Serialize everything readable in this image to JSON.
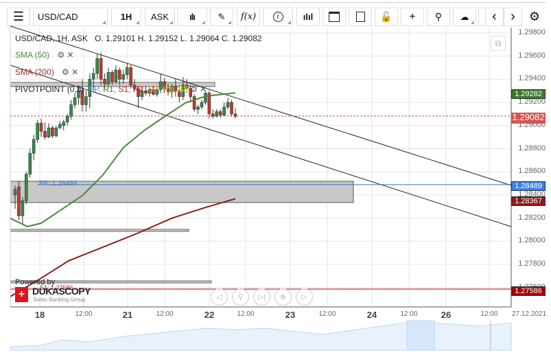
{
  "toolbar": {
    "menu_icon": "hamburger-icon",
    "instrument": "USD/CAD",
    "period": "1H",
    "side": "ASK",
    "chart_type_icon": "candles-icon",
    "draw_icon": "pencil-icon",
    "indicators_label": "f(x)",
    "info_icon": "info-icon",
    "volume_icon": "bar-chart-icon",
    "calendar_icon": "calendar-icon",
    "news_icon": "news-icon",
    "lock_icon": "unlock-icon",
    "crosshair_icon": "crosshair-icon",
    "zoom_icon": "zoom-chart-icon",
    "upload_icon": "cloud-upload-icon",
    "prev": "‹",
    "next": "›",
    "settings_icon": "gear-icon"
  },
  "header": {
    "title": "USD/CAD, 1H, ASK",
    "ohlc": "O. 1.29101 H. 1.29152 L. 1.29064 C. 1.29082"
  },
  "indicators": [
    {
      "label": "SMA (50)",
      "color": "#4a8a3a"
    },
    {
      "label": "SMA (200)",
      "color": "#a03030"
    }
  ],
  "pivot": {
    "label": "PIVOTPOINT (0,8)",
    "levels": [
      {
        "t": "PP,",
        "c": "#4a90e2"
      },
      {
        "t": "R1,",
        "c": "#3a8a2a"
      },
      {
        "t": "S1,",
        "c": "#c02020"
      },
      {
        "t": "R2,",
        "c": "#e02020"
      },
      {
        "t": "S2,",
        "c": "#f08000"
      },
      {
        "t": "R3,",
        "c": "#e0b000"
      },
      {
        "t": "S3",
        "c": "#f0e000"
      }
    ],
    "pp_text": "PP: 1.28489"
  },
  "price_axis": [
    "1.29800",
    "1.29600",
    "1.29400",
    "1.29200",
    "1.29000",
    "1.28800",
    "1.28600",
    "1.28400",
    "1.28200",
    "1.28000",
    "1.27800",
    "1.27600"
  ],
  "price_tags": {
    "sma50": "1.29282",
    "current": "1.29082",
    "pp": "1.28489",
    "sma200": "1.28367",
    "s1": "1.27586"
  },
  "s1_text": "S1: 1.27586",
  "time_axis": {
    "days": [
      "18",
      "21",
      "22",
      "23",
      "24",
      "26"
    ],
    "hours": [
      "12:00",
      "12:00",
      "12:00",
      "12:00",
      "12:00",
      "12:00"
    ],
    "date": "27.12.2021"
  },
  "branding": {
    "powered": "Powered by",
    "brand": "DUKASCOPY",
    "sub": "Swiss Banking Group"
  },
  "chart_data": {
    "type": "candlestick",
    "instrument": "USD/CAD",
    "ylim": [
      1.2745,
      1.2985
    ],
    "candles": [
      [
        1.284,
        1.2848,
        1.2828,
        1.2845
      ],
      [
        1.2847,
        1.2852,
        1.2818,
        1.2822
      ],
      [
        1.2822,
        1.2838,
        1.2815,
        1.2835
      ],
      [
        1.2835,
        1.286,
        1.2832,
        1.2858
      ],
      [
        1.2858,
        1.288,
        1.2855,
        1.2876
      ],
      [
        1.2876,
        1.2892,
        1.287,
        1.2888
      ],
      [
        1.2888,
        1.2905,
        1.2885,
        1.2902
      ],
      [
        1.2902,
        1.2906,
        1.289,
        1.2895
      ],
      [
        1.2895,
        1.2903,
        1.2888,
        1.289
      ],
      [
        1.289,
        1.2902,
        1.2889,
        1.2898
      ],
      [
        1.2898,
        1.29,
        1.2889,
        1.2891
      ],
      [
        1.2891,
        1.29,
        1.289,
        1.2898
      ],
      [
        1.2898,
        1.2904,
        1.2897,
        1.2901
      ],
      [
        1.29,
        1.2905,
        1.2896,
        1.2903
      ],
      [
        1.2903,
        1.291,
        1.29,
        1.2908
      ],
      [
        1.2908,
        1.2922,
        1.2905,
        1.2918
      ],
      [
        1.2918,
        1.2928,
        1.2915,
        1.2924
      ],
      [
        1.2924,
        1.2935,
        1.2918,
        1.293
      ],
      [
        1.293,
        1.294,
        1.2912,
        1.2918
      ],
      [
        1.2918,
        1.293,
        1.2912,
        1.2925
      ],
      [
        1.2925,
        1.2945,
        1.2915,
        1.294
      ],
      [
        1.294,
        1.295,
        1.293,
        1.2945
      ],
      [
        1.2945,
        1.2962,
        1.294,
        1.2958
      ],
      [
        1.2958,
        1.2963,
        1.2935,
        1.294
      ],
      [
        1.294,
        1.2945,
        1.2932,
        1.2936
      ],
      [
        1.2936,
        1.295,
        1.2934,
        1.2946
      ],
      [
        1.2946,
        1.2948,
        1.2935,
        1.2938
      ],
      [
        1.2938,
        1.2952,
        1.2936,
        1.2948
      ],
      [
        1.2948,
        1.295,
        1.2935,
        1.294
      ],
      [
        1.294,
        1.2948,
        1.2936,
        1.2944
      ],
      [
        1.2944,
        1.2954,
        1.294,
        1.295
      ],
      [
        1.295,
        1.2952,
        1.2932,
        1.2935
      ],
      [
        1.2935,
        1.294,
        1.293,
        1.2932
      ],
      [
        1.2932,
        1.2934,
        1.2915,
        1.2925
      ],
      [
        1.2925,
        1.2933,
        1.2922,
        1.293
      ],
      [
        1.293,
        1.2934,
        1.2926,
        1.2928
      ],
      [
        1.2928,
        1.2933,
        1.2925,
        1.2931
      ],
      [
        1.2931,
        1.2934,
        1.2926,
        1.2927
      ],
      [
        1.2927,
        1.2933,
        1.2925,
        1.2931
      ],
      [
        1.2931,
        1.2945,
        1.2928,
        1.2938
      ],
      [
        1.2938,
        1.2941,
        1.2928,
        1.2932
      ],
      [
        1.2932,
        1.2936,
        1.2926,
        1.2929
      ],
      [
        1.2929,
        1.2936,
        1.2924,
        1.2934
      ],
      [
        1.2934,
        1.294,
        1.2925,
        1.293
      ],
      [
        1.293,
        1.2935,
        1.292,
        1.2925
      ],
      [
        1.2925,
        1.2942,
        1.2922,
        1.2935
      ],
      [
        1.2935,
        1.294,
        1.2928,
        1.2932
      ],
      [
        1.2932,
        1.2935,
        1.292,
        1.2925
      ],
      [
        1.2925,
        1.2927,
        1.2912,
        1.2914
      ],
      [
        1.2914,
        1.2918,
        1.291,
        1.2916
      ],
      [
        1.2916,
        1.2922,
        1.2914,
        1.292
      ],
      [
        1.292,
        1.293,
        1.2918,
        1.2928
      ],
      [
        1.2928,
        1.293,
        1.2906,
        1.291
      ],
      [
        1.291,
        1.2914,
        1.2906,
        1.2908
      ],
      [
        1.2908,
        1.2914,
        1.2907,
        1.2912
      ],
      [
        1.2912,
        1.2914,
        1.2907,
        1.2909
      ],
      [
        1.2909,
        1.292,
        1.2908,
        1.2916
      ],
      [
        1.2916,
        1.2924,
        1.2914,
        1.292
      ],
      [
        1.292,
        1.2922,
        1.2908,
        1.291
      ],
      [
        1.291,
        1.2915,
        1.2906,
        1.2908
      ]
    ],
    "sma50": [
      [
        -1.3,
        1.28198
      ],
      [
        3.3,
        1.28127
      ],
      [
        7,
        1.28156
      ],
      [
        12.5,
        1.28275
      ],
      [
        18,
        1.28394
      ],
      [
        23.5,
        1.28572
      ],
      [
        29,
        1.28809
      ],
      [
        34.6,
        1.28958
      ],
      [
        40,
        1.29076
      ],
      [
        45.6,
        1.29195
      ],
      [
        51.1,
        1.29254
      ],
      [
        59,
        1.29282
      ]
    ],
    "sma200": [
      [
        -1.3,
        1.27521
      ],
      [
        7,
        1.27681
      ],
      [
        14.3,
        1.2783
      ],
      [
        32.7,
        1.28067
      ],
      [
        41.9,
        1.28198
      ],
      [
        51.1,
        1.28293
      ],
      [
        59,
        1.28367
      ]
    ],
    "levels": {
      "current": 1.29082,
      "pp": 1.28489,
      "s1": 1.27586
    }
  }
}
